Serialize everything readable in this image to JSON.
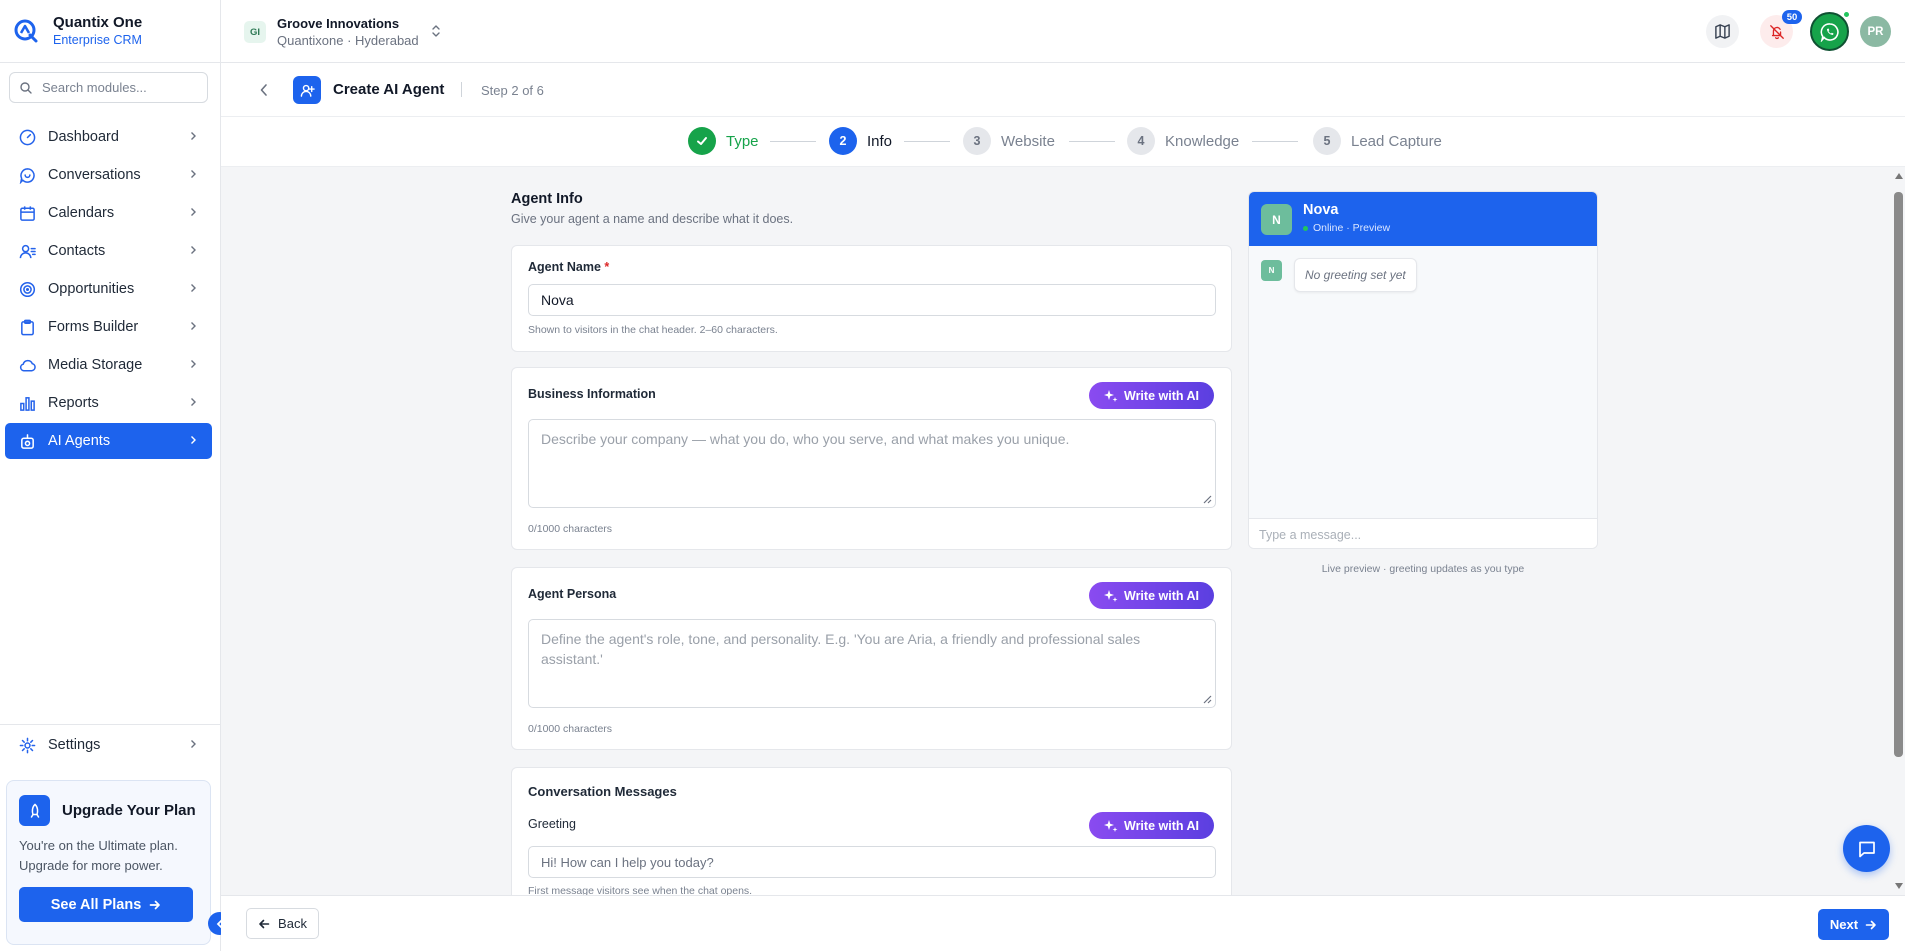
{
  "brand": {
    "name": "Quantix One",
    "subtitle": "Enterprise CRM"
  },
  "sidebar": {
    "search_placeholder": "Search modules...",
    "items": [
      {
        "label": "Dashboard",
        "icon": "gauge-icon"
      },
      {
        "label": "Conversations",
        "icon": "chat-bubble-icon"
      },
      {
        "label": "Calendars",
        "icon": "calendar-icon"
      },
      {
        "label": "Contacts",
        "icon": "contacts-icon"
      },
      {
        "label": "Opportunities",
        "icon": "target-icon"
      },
      {
        "label": "Forms Builder",
        "icon": "clipboard-icon"
      },
      {
        "label": "Media Storage",
        "icon": "cloud-icon"
      },
      {
        "label": "Reports",
        "icon": "bar-chart-icon"
      },
      {
        "label": "AI Agents",
        "icon": "robot-icon",
        "active": true
      }
    ],
    "settings_label": "Settings",
    "upgrade": {
      "title": "Upgrade Your Plan",
      "text": "You're on the Ultimate plan. Upgrade for more power.",
      "button": "See All Plans"
    }
  },
  "topbar": {
    "workspace_badge": "GI",
    "workspace_name": "Groove Innovations",
    "workspace_sub": "Quantixone · Hyderabad",
    "notification_count": "50",
    "avatar_initials": "PR"
  },
  "page": {
    "title": "Create AI Agent",
    "step_indicator": "Step 2 of 6"
  },
  "stepper": {
    "steps": [
      {
        "number": "1",
        "label": "Type",
        "state": "done"
      },
      {
        "number": "2",
        "label": "Info",
        "state": "current"
      },
      {
        "number": "3",
        "label": "Website",
        "state": "todo"
      },
      {
        "number": "4",
        "label": "Knowledge",
        "state": "todo"
      },
      {
        "number": "5",
        "label": "Lead Capture",
        "state": "todo"
      }
    ]
  },
  "form": {
    "section_title": "Agent Info",
    "section_subtitle": "Give your agent a name and describe what it does.",
    "agent_name": {
      "label": "Agent Name",
      "required_mark": "*",
      "value": "Nova",
      "hint": "Shown to visitors in the chat header. 2–60 characters."
    },
    "business_info": {
      "label": "Business Information",
      "ai_button": "Write with AI",
      "placeholder": "Describe your company — what you do, who you serve, and what makes you unique.",
      "counter": "0/1000 characters"
    },
    "persona": {
      "label": "Agent Persona",
      "ai_button": "Write with AI",
      "placeholder": "Define the agent's role, tone, and personality. E.g. 'You are Aria, a friendly and professional sales assistant.'",
      "counter": "0/1000 characters"
    },
    "conversation": {
      "title": "Conversation Messages",
      "greeting_label": "Greeting",
      "ai_button": "Write with AI",
      "greeting_value": "Hi! How can I help you today?",
      "hint": "First message visitors see when the chat opens."
    }
  },
  "preview": {
    "avatar": "N",
    "name": "Nova",
    "status": "Online · Preview",
    "message_avatar": "N",
    "empty_greeting": "No greeting set yet",
    "input_placeholder": "Type a message...",
    "caption": "Live preview · greeting updates as you type"
  },
  "footer": {
    "back_label": "Back",
    "next_label": "Next"
  },
  "colors": {
    "primary": "#1d63ed",
    "success": "#16a34a",
    "ai_gradient_start": "#8a4bf0",
    "ai_gradient_end": "#5b3fe0"
  }
}
